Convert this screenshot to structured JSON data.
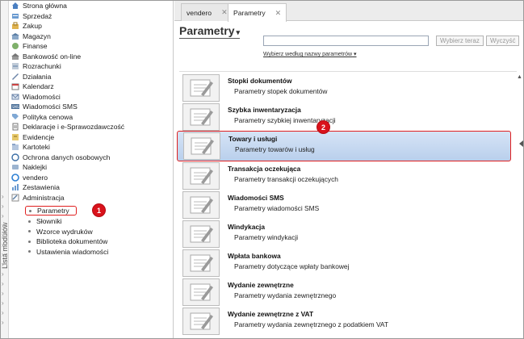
{
  "sidebar": {
    "strip_label": "Lista modułów",
    "items": [
      {
        "label": "Strona główna",
        "icon": "home-icon"
      },
      {
        "label": "Sprzedaż",
        "icon": "sales-icon"
      },
      {
        "label": "Zakup",
        "icon": "purchase-icon"
      },
      {
        "label": "Magazyn",
        "icon": "warehouse-icon"
      },
      {
        "label": "Finanse",
        "icon": "finance-icon"
      },
      {
        "label": "Bankowość on-line",
        "icon": "bank-icon"
      },
      {
        "label": "Rozrachunki",
        "icon": "settlements-icon"
      },
      {
        "label": "Działania",
        "icon": "actions-icon"
      },
      {
        "label": "Kalendarz",
        "icon": "calendar-icon"
      },
      {
        "label": "Wiadomości",
        "icon": "mail-icon"
      },
      {
        "label": "Wiadomości SMS",
        "icon": "sms-icon"
      },
      {
        "label": "Polityka cenowa",
        "icon": "pricing-icon"
      },
      {
        "label": "Deklaracje i e-Sprawozdawczość",
        "icon": "declarations-icon"
      },
      {
        "label": "Ewidencje",
        "icon": "records-icon"
      },
      {
        "label": "Kartoteki",
        "icon": "files-icon"
      },
      {
        "label": "Ochrona danych osobowych",
        "icon": "privacy-icon"
      },
      {
        "label": "Naklejki",
        "icon": "labels-icon"
      },
      {
        "label": "vendero",
        "icon": "vendero-icon"
      },
      {
        "label": "Zestawienia",
        "icon": "reports-icon"
      },
      {
        "label": "Administracja",
        "icon": "admin-icon"
      }
    ],
    "subitems": [
      {
        "label": "Parametry"
      },
      {
        "label": "Słowniki"
      },
      {
        "label": "Wzorce wydruków"
      },
      {
        "label": "Biblioteka dokumentów"
      },
      {
        "label": "Ustawienia wiadomości"
      }
    ]
  },
  "tabs": [
    {
      "label": "vendero"
    },
    {
      "label": "Parametry"
    }
  ],
  "page": {
    "title": "Parametry",
    "search_placeholder": "",
    "clear_button": "Wybierz teraz",
    "clean_button": "Wyczyść",
    "search_hint": "Wybierz według nazwy parametrów"
  },
  "badges": [
    "1",
    "2"
  ],
  "params": [
    {
      "title": "Stopki dokumentów",
      "desc": "Parametry stopek dokumentów"
    },
    {
      "title": "Szybka inwentaryzacja",
      "desc": "Parametry szybkiej inwentaryzacji"
    },
    {
      "title": "Towary i usługi",
      "desc": "Parametry towarów i usług"
    },
    {
      "title": "Transakcja oczekująca",
      "desc": "Parametry transakcji oczekujących"
    },
    {
      "title": "Wiadomości SMS",
      "desc": "Parametry wiadomości SMS"
    },
    {
      "title": "Windykacja",
      "desc": "Parametry windykacji"
    },
    {
      "title": "Wpłata bankowa",
      "desc": "Parametry dotyczące wpłaty bankowej"
    },
    {
      "title": "Wydanie zewnętrzne",
      "desc": "Parametry wydania zewnętrznego"
    },
    {
      "title": "Wydanie zewnętrzne z VAT",
      "desc": "Parametry wydania zewnętrznego z podatkiem VAT"
    }
  ],
  "colors": {
    "highlight": "#e02020",
    "badge": "#d9121b",
    "selection": "#c6d8f0"
  }
}
